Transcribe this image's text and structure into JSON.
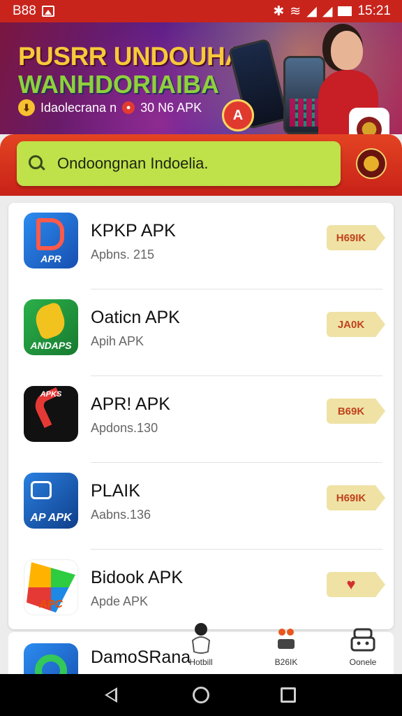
{
  "status_bar": {
    "time_left": "B88",
    "time": "15:21"
  },
  "banner": {
    "title_line1": "PUSRR UNDOUHAN",
    "title_line2": "WANHDORIAIBA",
    "subtitle_prefix": "Idaolecrana n",
    "subtitle_suffix": "30 N6 APK",
    "badge_letter": "A"
  },
  "search": {
    "query": "Ondoongnan Indoelia."
  },
  "apps": [
    {
      "title": "KPKP APK",
      "subtitle": "Apbns. 215",
      "action": "H69IK",
      "icon_tag": "APR",
      "icon_color": "#1e74d8"
    },
    {
      "title": "Oaticn APK",
      "subtitle": "Apih APK",
      "action": "JA0K",
      "icon_color": "#1c9a3a",
      "icon_tag": "ANDAPS"
    },
    {
      "title": "APR! APK",
      "subtitle": "Apdons.130",
      "action": "B69K",
      "icon_color": "#111111",
      "icon_tag": "APKS"
    },
    {
      "title": "PLAIK",
      "subtitle": "Aabns.136",
      "action": "H69IK",
      "icon_color": "#1a5fb8",
      "icon_tag": "AP APK"
    },
    {
      "title": "Bidook APK",
      "subtitle": "Apde APK",
      "action": "",
      "icon_color": "#ffffff",
      "icon_tag": "APC"
    },
    {
      "title": "DamoSRana",
      "subtitle": "",
      "action": "",
      "icon_color": "#1e74d8",
      "icon_tag": ""
    }
  ],
  "tabs": [
    {
      "label": "Hotbill",
      "icon": "hand-icon"
    },
    {
      "label": "B26IK",
      "icon": "dots-icon"
    },
    {
      "label": "Oonele",
      "icon": "robot-icon"
    }
  ],
  "colors": {
    "accent": "#c8241c",
    "search_bg": "#bfe14a",
    "button_bg": "#efe2a4"
  }
}
